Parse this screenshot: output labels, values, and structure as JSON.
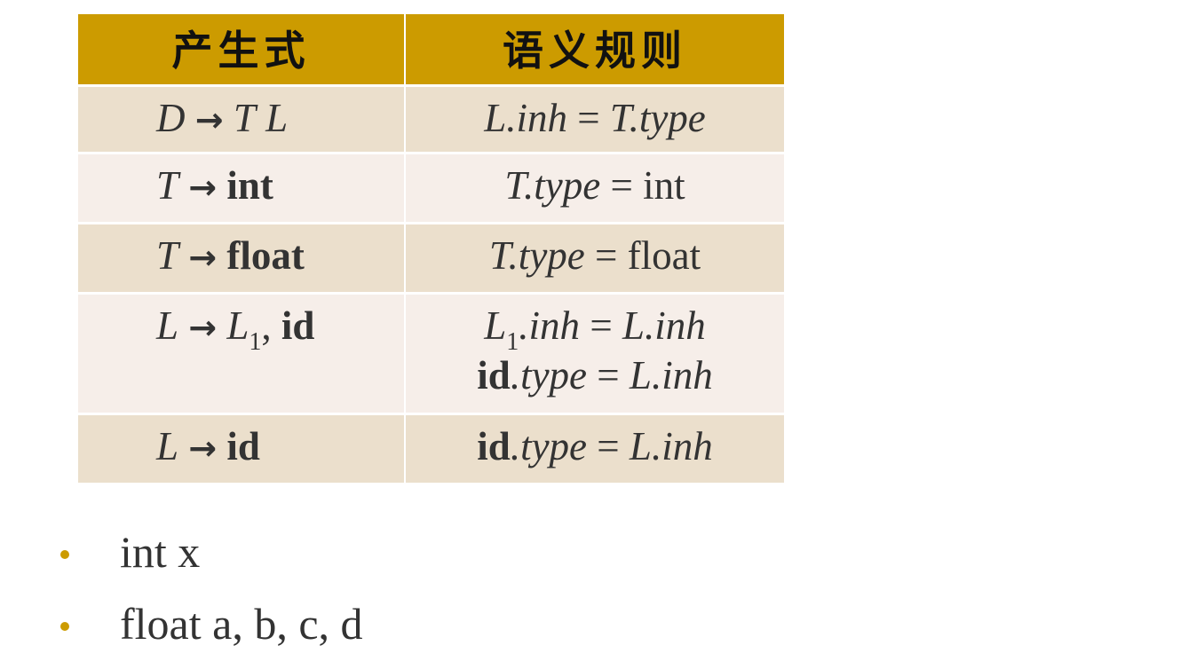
{
  "table": {
    "headers": [
      "产生式",
      "语义规则"
    ],
    "rows": [
      {
        "production": {
          "lhs": "D",
          "arrow": "→",
          "rhs1": "T",
          "rhs2": "L"
        },
        "rule": {
          "lhs": "L.inh",
          "eq": "=",
          "rhs": "T.type"
        }
      },
      {
        "production": {
          "lhs": "T",
          "arrow": "→",
          "keyword": "int"
        },
        "rule": {
          "lhs": "T.type",
          "eq": "=",
          "rhs": "int"
        }
      },
      {
        "production": {
          "lhs": "T",
          "arrow": "→",
          "keyword": "float"
        },
        "rule": {
          "lhs": "T.type",
          "eq": "=",
          "rhs": "float"
        }
      },
      {
        "production": {
          "lhs": "L",
          "arrow": "→",
          "rhs_base": "L",
          "rhs_sub": "1",
          "comma": ",",
          "keyword": "id"
        },
        "rules": [
          {
            "lhs_base": "L",
            "lhs_sub": "1",
            "lhs_attr": ".inh",
            "eq": "=",
            "rhs": "L.inh"
          },
          {
            "lhs_kw": "id",
            "lhs_attr": ".type",
            "eq": "=",
            "rhs": "L.inh"
          }
        ]
      },
      {
        "production": {
          "lhs": "L",
          "arrow": "→",
          "keyword": "id"
        },
        "rule": {
          "lhs_kw": "id",
          "lhs_attr": ".type",
          "eq": "=",
          "rhs": "L.inh"
        }
      }
    ]
  },
  "examples": [
    "int x",
    "float a, b, c, d"
  ],
  "colors": {
    "header_bg": "#cc9b00",
    "row_odd_bg": "#ebdfcc",
    "row_even_bg": "#f6eee9",
    "bullet": "#cc9b00",
    "text": "#333333"
  }
}
